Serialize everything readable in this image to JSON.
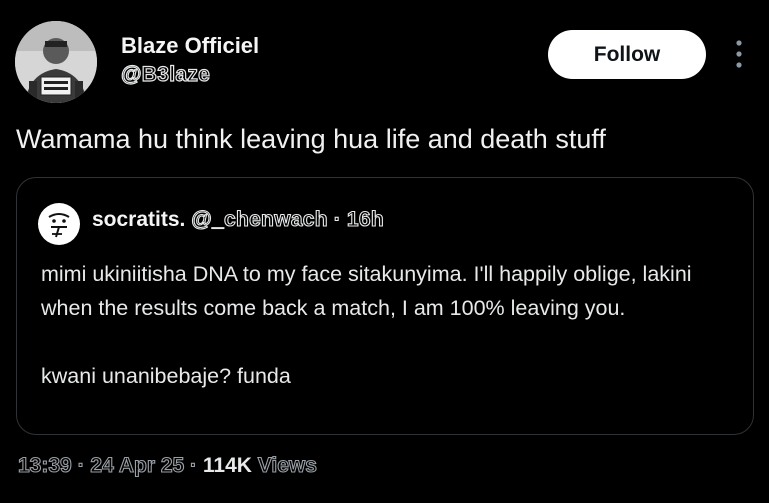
{
  "author": {
    "name": "Blaze Officiel",
    "handle": "@B3laze",
    "avatar_icon": "user-avatar-photo"
  },
  "follow_label": "Follow",
  "more_icon": "more-vertical-icon",
  "tweet_text": "Wamama hu think leaving hua life and death stuff",
  "quote": {
    "name": "socratits.",
    "handle": "@_chenwach",
    "separator": "·",
    "age": "16h",
    "avatar_icon": "doodle-face-avatar",
    "body_line_1": "mimi ukiniitisha DNA to my face sitakunyima. I'll happily oblige, lakini when the results come back a match, I am 100% leaving you.",
    "body_line_2": "kwani unanibebaje? funda"
  },
  "meta": {
    "time": "13:39",
    "sep1": "·",
    "date": "24 Apr 25",
    "sep2": "·",
    "views_count": "114K",
    "views_label": "Views"
  },
  "colors": {
    "background": "#000000",
    "text": "#e7e9ea",
    "border": "#2f3336",
    "follow_bg": "#ffffff",
    "follow_text": "#0f1419"
  }
}
